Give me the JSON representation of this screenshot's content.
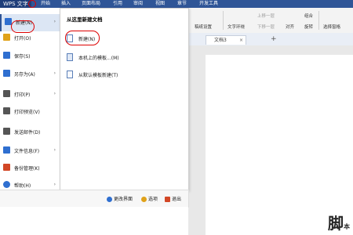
{
  "titlebar": {
    "app_label": "WPS 文字",
    "tabs": [
      "开始",
      "插入",
      "页面布局",
      "引用",
      "审阅",
      "视图",
      "章节",
      "开发工具"
    ]
  },
  "ribbon": {
    "items": [
      "稿纸设置",
      "文字环绕",
      "上移一层",
      "下移一层",
      "对齐",
      "组合",
      "旋转",
      "选择窗格"
    ]
  },
  "tabbar": {
    "doc_tab": "文档3",
    "close": "×",
    "add": "+"
  },
  "menu": {
    "items": [
      {
        "label": "新建(N)",
        "icon": "new-file-icon",
        "color": "#2f6fd0",
        "chevron": true
      },
      {
        "label": "打开(O)",
        "icon": "open-folder-icon",
        "color": "#e0a21a",
        "chevron": false
      },
      {
        "label": "保存(S)",
        "icon": "save-icon",
        "color": "#2f6fd0",
        "chevron": false
      },
      {
        "label": "另存为(A)",
        "icon": "save-as-icon",
        "color": "#2f6fd0",
        "chevron": true
      },
      {
        "label": "打印(P)",
        "icon": "print-icon",
        "color": "#555555",
        "chevron": true
      },
      {
        "label": "打印预览(V)",
        "icon": "print-preview-icon",
        "color": "#555555",
        "chevron": false
      },
      {
        "label": "发送邮件(D)",
        "icon": "mail-icon",
        "color": "#555555",
        "chevron": false
      },
      {
        "label": "文件信息(F)",
        "icon": "file-info-icon",
        "color": "#2f6fd0",
        "chevron": true
      },
      {
        "label": "备份管理(K)",
        "icon": "backup-icon",
        "color": "#d24726",
        "chevron": false
      },
      {
        "label": "帮助(H)",
        "icon": "help-icon",
        "color": "#2f6fd0",
        "chevron": true
      }
    ]
  },
  "submenu": {
    "title": "从这里新建文档",
    "items": [
      {
        "label": "新建(N)",
        "icon": "blank-doc-icon"
      },
      {
        "label": "本机上的模板...(M)",
        "icon": "template-icon"
      },
      {
        "label": "从默认模板新建(T)",
        "icon": "default-template-icon"
      }
    ]
  },
  "footer": {
    "change_ui": "更改界面",
    "options": "选项",
    "exit": "退出"
  },
  "colors": {
    "accent": "#2f5597",
    "highlight_circle": "#dd0000"
  }
}
